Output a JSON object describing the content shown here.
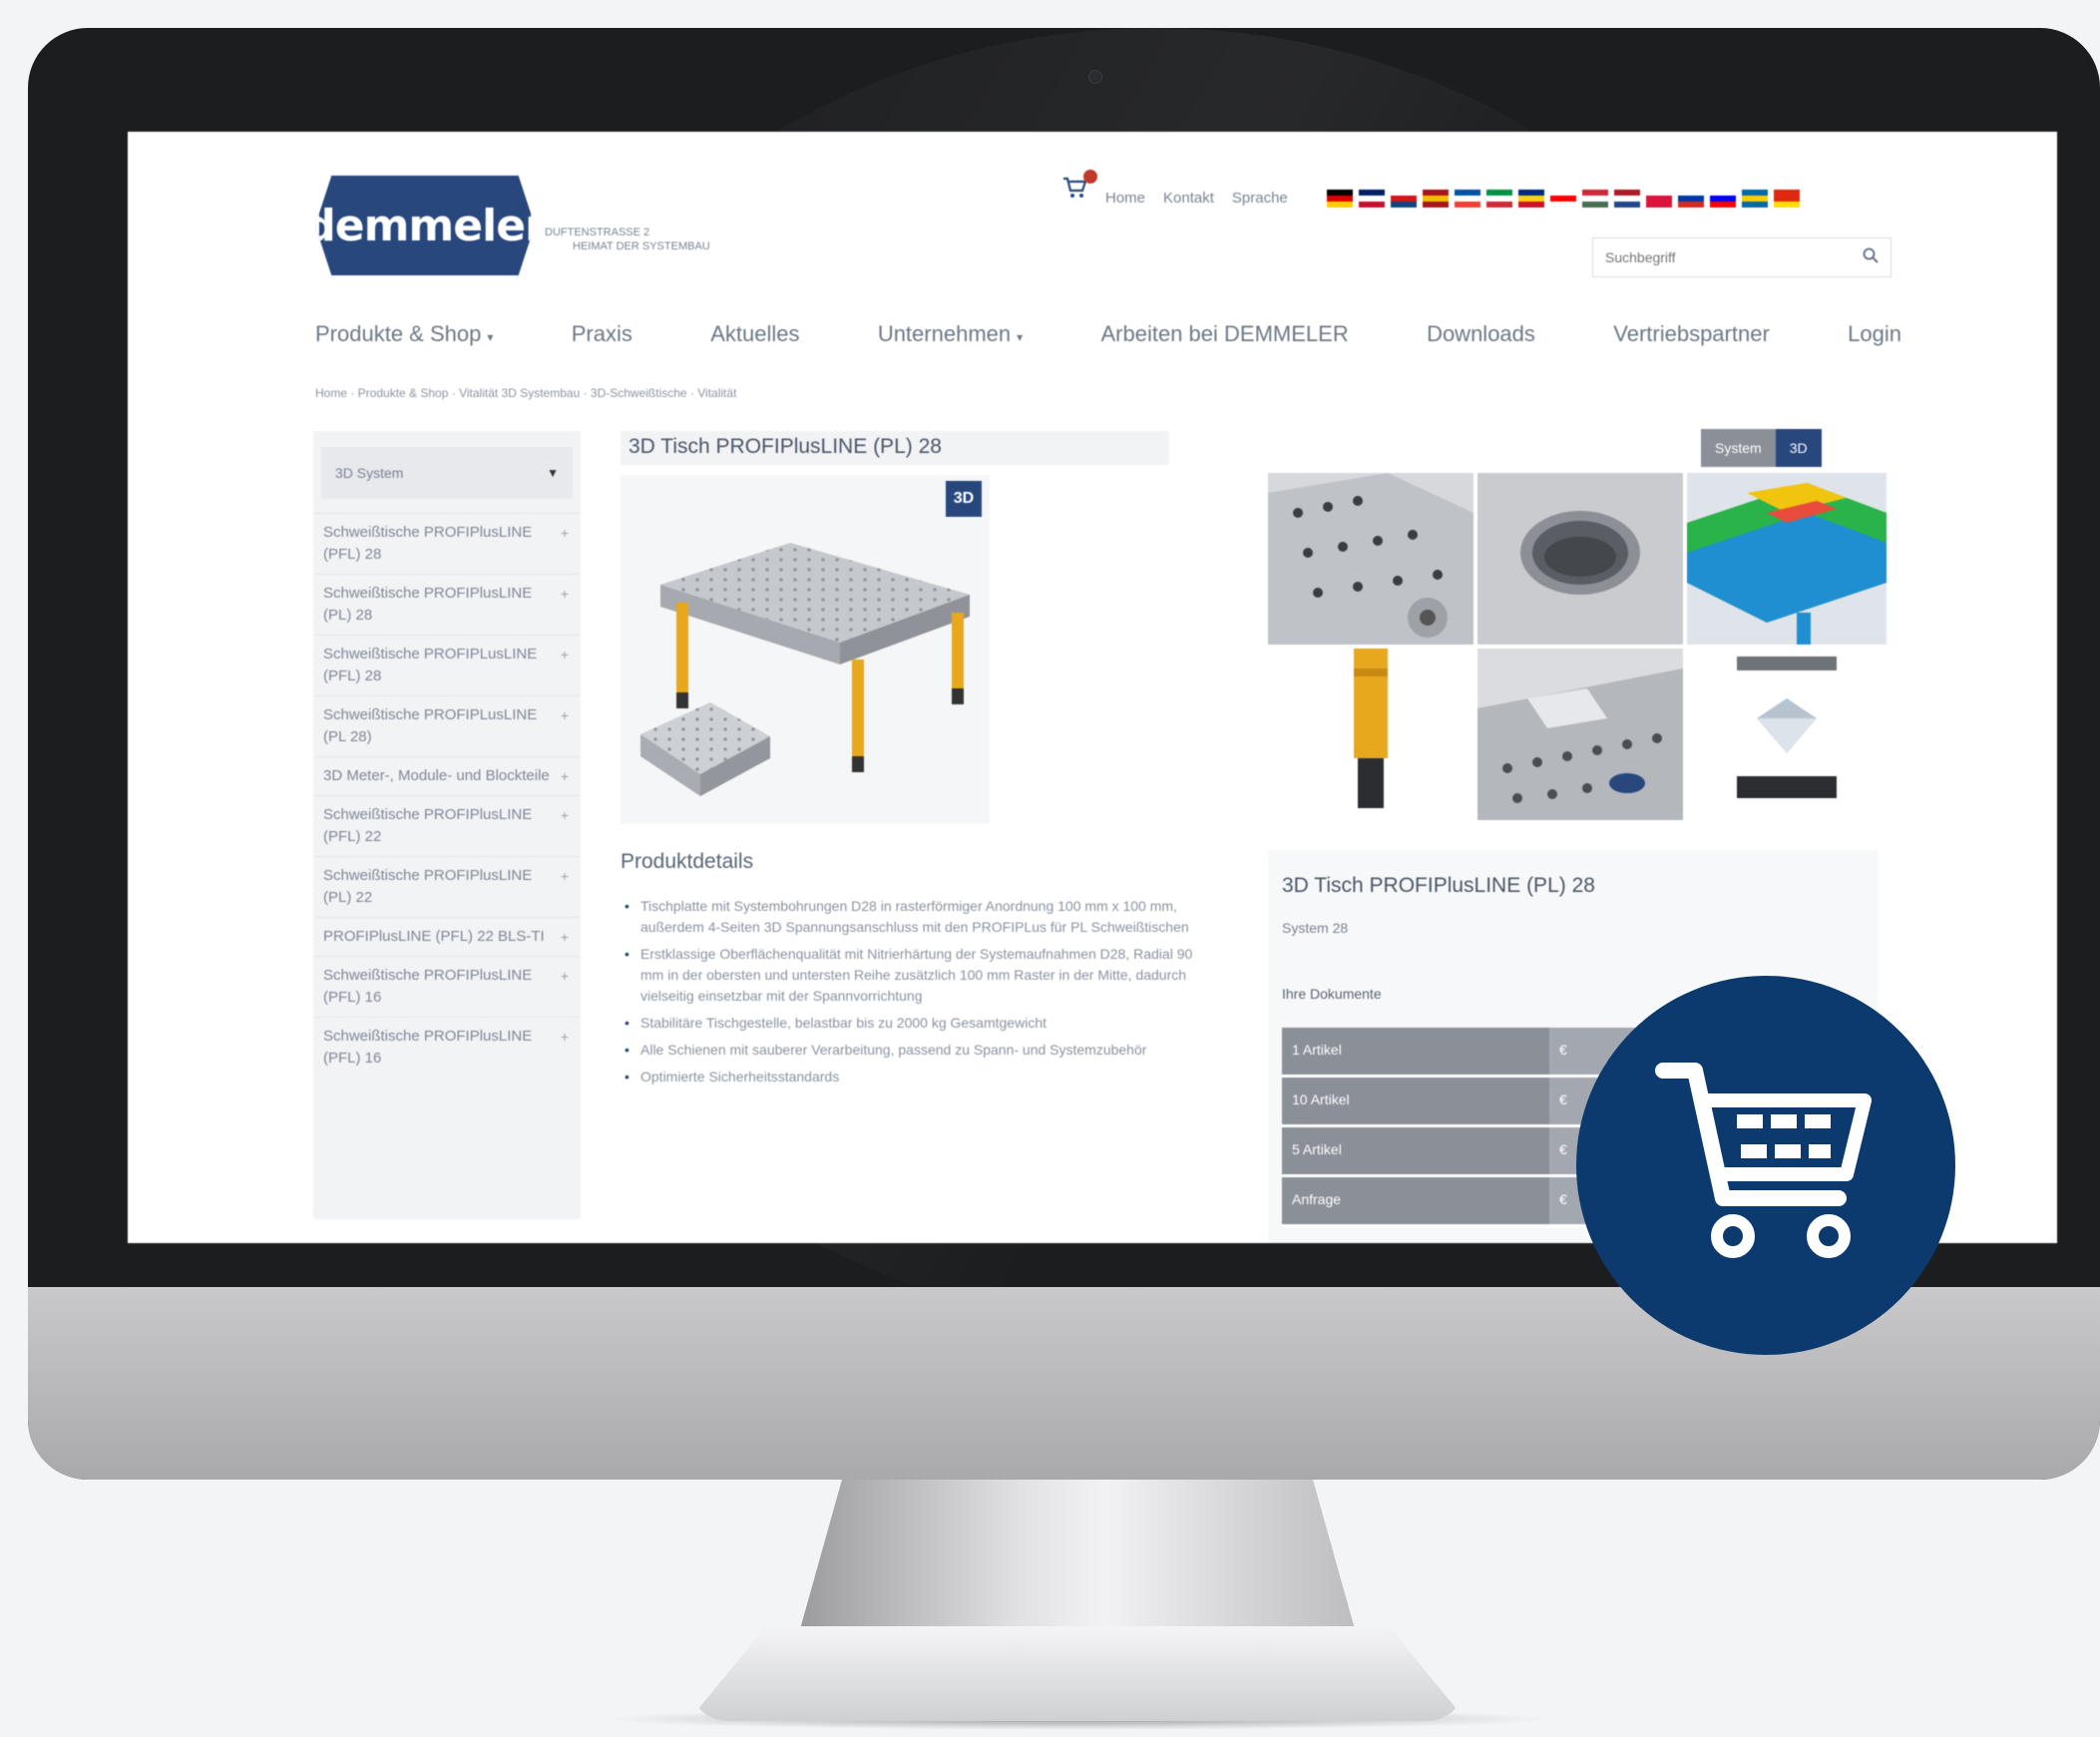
{
  "brand": {
    "logo_text": "demmeler",
    "tagline_line1": "DUFTENSTRASSE 2",
    "tagline_line2": "HEIMAT DER SYSTEMBAU"
  },
  "header": {
    "cart_count": "0",
    "links": [
      "Home",
      "Kontakt",
      "Sprache"
    ],
    "flags": [
      {
        "name": "de-flag-icon",
        "colors": [
          "#000000",
          "#dd0000",
          "#ffce00"
        ]
      },
      {
        "name": "uk-flag-icon",
        "colors": [
          "#012169",
          "#ffffff",
          "#c8102e"
        ]
      },
      {
        "name": "cz-flag-icon",
        "colors": [
          "#ffffff",
          "#d7141a",
          "#11457e"
        ]
      },
      {
        "name": "es-flag-icon",
        "colors": [
          "#aa151b",
          "#f1bf00",
          "#aa151b"
        ]
      },
      {
        "name": "fr-flag-icon",
        "colors": [
          "#0055a4",
          "#ffffff",
          "#ef4135"
        ]
      },
      {
        "name": "it-flag-icon",
        "colors": [
          "#009246",
          "#ffffff",
          "#ce2b37"
        ]
      },
      {
        "name": "ro-flag-icon",
        "colors": [
          "#002b7f",
          "#fcd116",
          "#ce1126"
        ]
      },
      {
        "name": "ca-flag-icon",
        "colors": [
          "#ffffff",
          "#ff0000",
          "#ffffff"
        ]
      },
      {
        "name": "hu-flag-icon",
        "colors": [
          "#ce2939",
          "#ffffff",
          "#477050"
        ]
      },
      {
        "name": "nl-flag-icon",
        "colors": [
          "#ae1c28",
          "#ffffff",
          "#21468b"
        ]
      },
      {
        "name": "pl-flag-icon",
        "colors": [
          "#ffffff",
          "#dc143c",
          "#dc143c"
        ]
      },
      {
        "name": "ru-flag-icon",
        "colors": [
          "#ffffff",
          "#0039a6",
          "#d52b1e"
        ]
      },
      {
        "name": "si-flag-icon",
        "colors": [
          "#ffffff",
          "#0000ff",
          "#ff0000"
        ]
      },
      {
        "name": "se-flag-icon",
        "colors": [
          "#006aa7",
          "#fecc00",
          "#006aa7"
        ]
      },
      {
        "name": "cn-flag-icon",
        "colors": [
          "#de2910",
          "#de2910",
          "#ffde00"
        ]
      }
    ],
    "search_placeholder": "Suchbegriff"
  },
  "nav": {
    "items": [
      {
        "label": "Produkte & Shop",
        "caret": "▾"
      },
      {
        "label": "Praxis"
      },
      {
        "label": "Aktuelles"
      },
      {
        "label": "Unternehmen",
        "caret": "▾"
      },
      {
        "label": "Arbeiten bei DEMMELER"
      },
      {
        "label": "Downloads"
      },
      {
        "label": "Vertriebspartner"
      },
      {
        "label": "Login"
      }
    ]
  },
  "breadcrumb": "Home · Produkte & Shop · Vitalität 3D Systembau · 3D-Schweißtische · Vitalität",
  "sidebar": {
    "select_label": "3D System",
    "items": [
      "Schweißtische PROFIPlusLINE (PFL) 28",
      "Schweißtische PROFIPlusLINE (PL) 28",
      "Schweißtische PROFIPLusLINE (PFL) 28",
      "Schweißtische PROFIPLusLINE (PL 28)",
      "3D Meter-, Module- und Blockteile",
      "Schweißtische PROFIPlusLINE (PFL) 22",
      "Schweißtische PROFIPlusLINE (PL) 22",
      "PROFIPlusLINE (PFL) 22 BLS-TI",
      "Schweißtische PROFIPlusLINE (PFL) 16",
      "Schweißtische PROFIPlusLINE (PFL) 16"
    ]
  },
  "product": {
    "title": "3D Tisch PROFIPlusLINE (PL) 28",
    "badge": "3D",
    "details_title": "Produktdetails",
    "details": [
      "Tischplatte mit Systembohrungen D28 in rasterförmiger Anordnung 100 mm x 100 mm, außerdem 4-Seiten 3D Spannungsanschluss mit den PROFIPLus für PL Schweißtischen",
      "Erstklassige Oberflächenqualität mit Nitrierhärtung der Systemaufnahmen D28, Radial 90 mm in der obersten und untersten Reihe zusätzlich 100 mm Raster in der Mitte, dadurch vielseitig einsetzbar mit der Spannvorrichtung",
      "Stabilitäre Tischgestelle, belastbar bis zu 2000 kg Gesamtgewicht",
      "Alle Schienen mit sauberer Verarbeitung, passend zu Spann- und Systemzubehör",
      "Optimierte Sicherheitsstandards"
    ]
  },
  "tabs": [
    "System",
    "3D"
  ],
  "infobox": {
    "title": "3D Tisch PROFIPlusLINE (PL) 28",
    "system": "System 28",
    "docs_label": "Ihre Dokumente",
    "price_rows": [
      {
        "qty": "1 Artikel",
        "price": "€"
      },
      {
        "qty": "10 Artikel",
        "price": "€"
      },
      {
        "qty": "5 Artikel",
        "price": "€"
      },
      {
        "qty": "Anfrage",
        "price": "€"
      }
    ]
  },
  "colors": {
    "brand_blue": "#27477d",
    "badge_blue": "#0d3a6e",
    "table_leg_yellow": "#e8a81e"
  },
  "icons": {
    "mini_cart": "cart-icon",
    "search": "search-icon",
    "large_cart": "shopping-cart-icon"
  }
}
